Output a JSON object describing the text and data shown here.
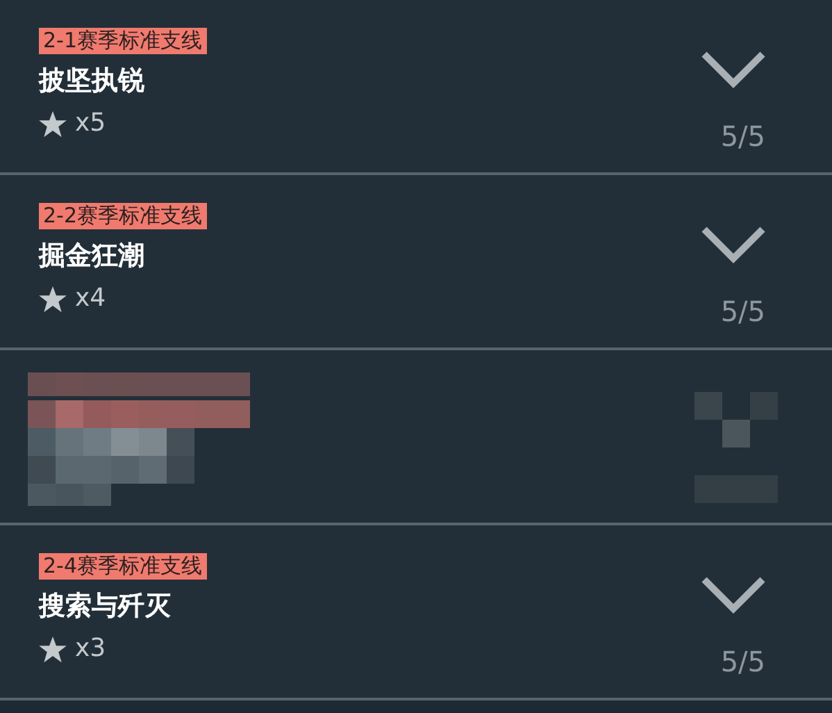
{
  "quests": [
    {
      "kind": "quest",
      "tag": "2-1赛季标准支线",
      "title": "披坚执锐",
      "stars_label": "x5",
      "progress": "5/5"
    },
    {
      "kind": "quest",
      "tag": "2-2赛季标准支线",
      "title": "掘金狂潮",
      "stars_label": "x4",
      "progress": "5/5"
    },
    {
      "kind": "redacted"
    },
    {
      "kind": "quest",
      "tag": "2-4赛季标准支线",
      "title": "搜索与歼灭",
      "stars_label": "x3",
      "progress": "5/5"
    }
  ]
}
